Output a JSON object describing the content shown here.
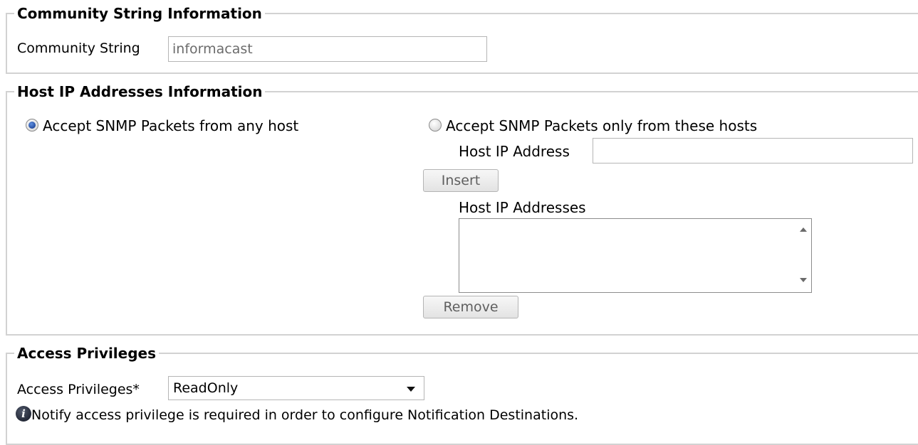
{
  "community_section": {
    "legend": "Community String Information",
    "community_string_label": "Community String",
    "community_string_value": "informacast"
  },
  "host_section": {
    "legend": "Host IP Addresses Information",
    "accept_any_label": "Accept SNMP Packets from any host",
    "accept_any_checked": true,
    "accept_only_label": "Accept SNMP Packets only from these hosts",
    "accept_only_checked": false,
    "host_ip_address_label": "Host IP Address",
    "host_ip_address_value": "",
    "insert_label": "Insert",
    "host_ip_addresses_label": "Host IP Addresses",
    "host_ip_addresses_items": [],
    "remove_label": "Remove"
  },
  "access_section": {
    "legend": "Access Privileges",
    "access_privileges_label": "Access Privileges*",
    "access_privileges_selected": "ReadOnly",
    "info_icon": "info-icon",
    "notify_text": "Notify access privilege is required in order to configure Notification Destinations."
  },
  "colors": {
    "border": "#d2d2d2",
    "radio_selected": "#1a3f9a",
    "button_text": "#5f5f5f"
  }
}
